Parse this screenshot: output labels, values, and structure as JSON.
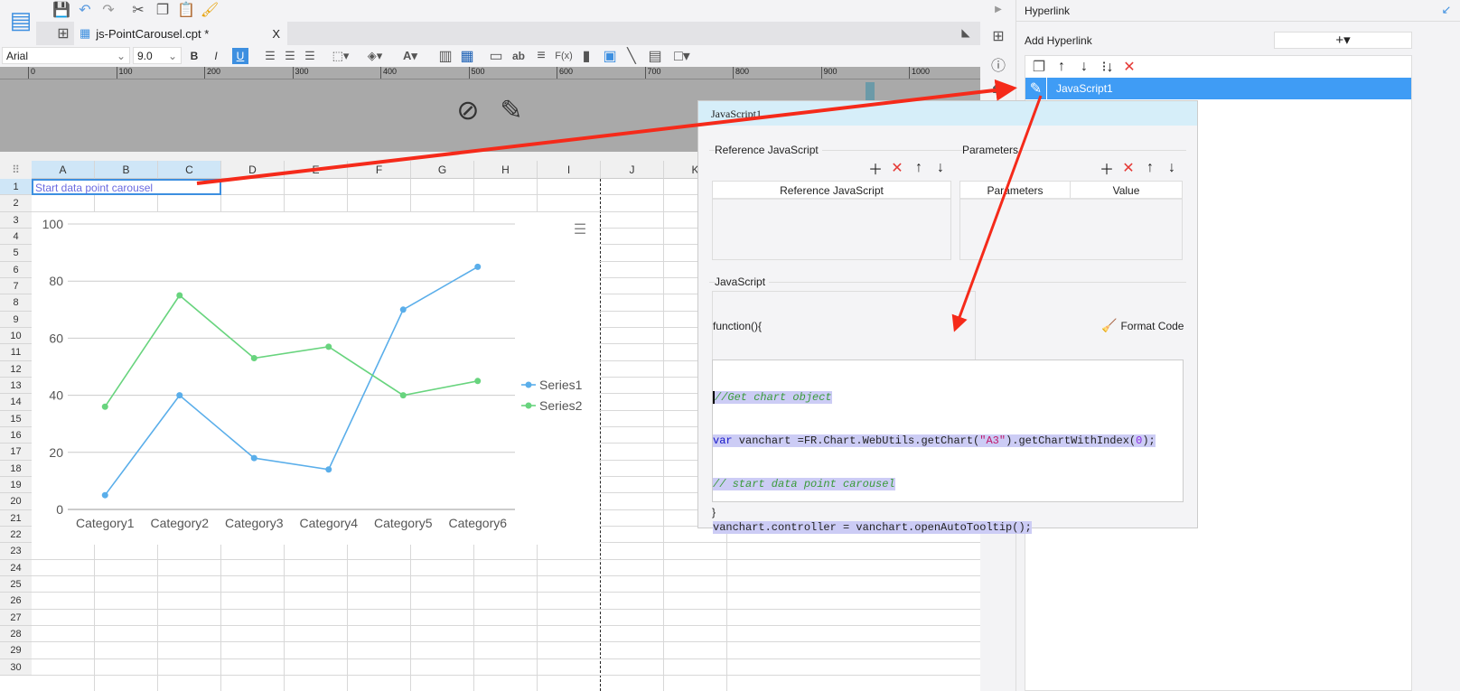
{
  "toolbar": {
    "tab_title": "js-PointCarousel.cpt *",
    "tab_close": "X",
    "font": "Arial",
    "size": "9.0",
    "bold": "B",
    "italic": "I",
    "underline": "U"
  },
  "ruler": {
    "ticks": [
      "0",
      "100",
      "200",
      "300",
      "400",
      "500",
      "600",
      "700",
      "800",
      "900",
      "1000"
    ]
  },
  "sheet": {
    "columns": [
      "A",
      "B",
      "C",
      "D",
      "E",
      "F",
      "G",
      "H",
      "I",
      "J",
      "K"
    ],
    "rows": [
      "1",
      "2",
      "3",
      "4",
      "5",
      "6",
      "7",
      "8",
      "9",
      "10",
      "11",
      "12",
      "13",
      "14",
      "15",
      "16",
      "17",
      "18",
      "19",
      "20",
      "21",
      "22",
      "23",
      "24",
      "25",
      "26",
      "27",
      "28",
      "29",
      "30"
    ],
    "cell_a1": "Start data point carousel"
  },
  "chart_data": {
    "type": "line",
    "categories": [
      "Category1",
      "Category2",
      "Category3",
      "Category4",
      "Category5",
      "Category6"
    ],
    "series": [
      {
        "name": "Series1",
        "color": "#5aaeea",
        "values": [
          5,
          40,
          18,
          14,
          70,
          85
        ]
      },
      {
        "name": "Series2",
        "color": "#68d47e",
        "values": [
          36,
          75,
          53,
          57,
          40,
          45
        ]
      }
    ],
    "ylim": [
      0,
      100
    ],
    "yticks": [
      "0",
      "20",
      "40",
      "60",
      "80",
      "100"
    ],
    "legend": "right",
    "grid": true
  },
  "panel": {
    "title": "Hyperlink",
    "add_label": "Add Hyperlink",
    "add_btn": "+▾",
    "items": [
      "JavaScript1"
    ]
  },
  "dialog": {
    "title": "JavaScript1",
    "ref_section": "Reference JavaScript",
    "ref_header": "Reference JavaScript",
    "param_section": "Parameters",
    "param_col1": "Parameters",
    "param_col2": "Value",
    "js_section": "JavaScript",
    "fn_open": "function(){",
    "format_code": "Format Code",
    "fn_close": "}",
    "code": [
      "//Get chart object",
      "var vanchart =FR.Chart.WebUtils.getChart(\"A3\").getChartWithIndex(0);",
      "// start data point carousel",
      "vanchart.controller = vanchart.openAutoTooltip();"
    ]
  }
}
